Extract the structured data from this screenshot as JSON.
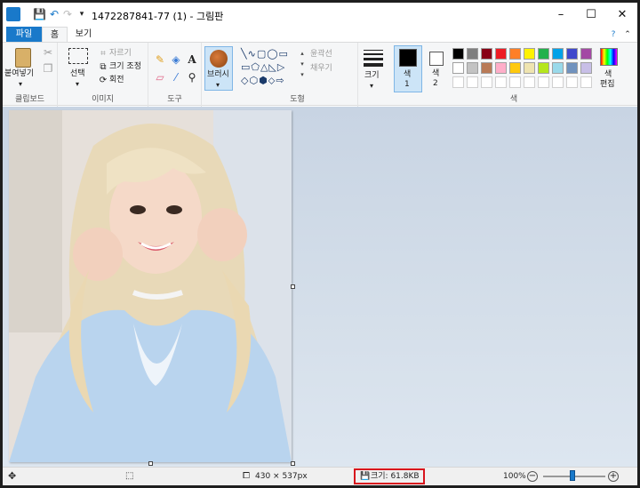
{
  "window": {
    "title": "1472287841-77 (1) - 그림판",
    "controls": {
      "minimize": "–",
      "maximize": "☐",
      "close": "✕"
    }
  },
  "quick_access": {
    "save_icon": "💾",
    "undo_icon": "↶",
    "redo_icon": "↷",
    "customize_icon": "▾"
  },
  "tabs": {
    "file": "파일",
    "home": "홈",
    "view": "보기"
  },
  "ribbon": {
    "clipboard": {
      "paste": "붙여넣기",
      "label": "클립보드"
    },
    "image": {
      "select": "선택",
      "crop": "자르기",
      "resize": "크기 조정",
      "rotate": "회전",
      "label": "이미지"
    },
    "tools": {
      "label": "도구"
    },
    "brushes": {
      "label": "브러시"
    },
    "shapes": {
      "outline": "윤곽선",
      "fill": "채우기",
      "label": "도형"
    },
    "size": {
      "label": "크기"
    },
    "colors": {
      "color1": "색\n1",
      "color1_label": "색",
      "color1_num": "1",
      "color2_label": "색",
      "color2_num": "2",
      "edit_label": "색",
      "edit_label2": "편집",
      "label": "색",
      "color1_value": "#000000",
      "color2_value": "#ffffff",
      "palette_row1": [
        "#000000",
        "#7f7f7f",
        "#880015",
        "#ed1c24",
        "#ff7f27",
        "#fff200",
        "#22b14c",
        "#00a2e8",
        "#3f48cc",
        "#a349a4"
      ],
      "palette_row2": [
        "#ffffff",
        "#c3c3c3",
        "#b97a57",
        "#ffaec9",
        "#ffc90e",
        "#efe4b0",
        "#b5e61d",
        "#99d9ea",
        "#7092be",
        "#c8bfe7"
      ]
    }
  },
  "status": {
    "dimensions": "430 × 537px",
    "file_size": "크기: 61.8KB",
    "zoom": "100%"
  },
  "accent_color": "#1979ca",
  "highlight_color": "#d8141d"
}
